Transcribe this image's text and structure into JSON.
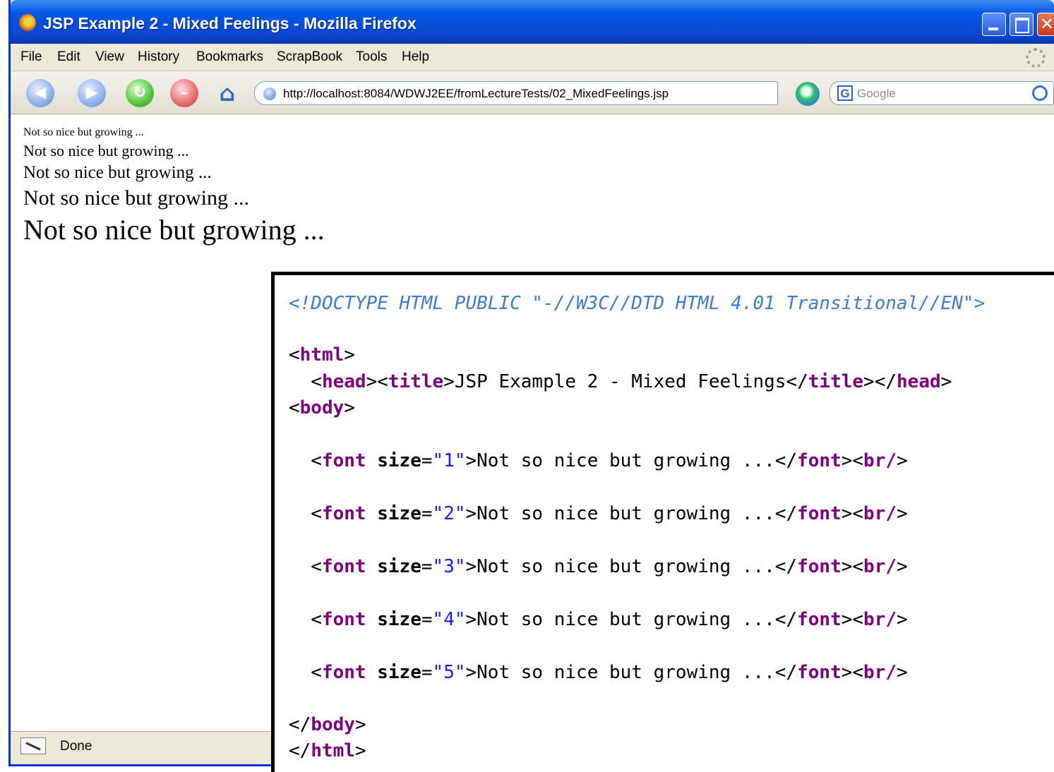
{
  "window": {
    "title": "JSP Example 2 - Mixed Feelings - Mozilla Firefox",
    "controls": [
      "minimize",
      "maximize",
      "close"
    ]
  },
  "menu": [
    "File",
    "Edit",
    "View",
    "History",
    "Bookmarks",
    "ScrapBook",
    "Tools",
    "Help"
  ],
  "toolbar": {
    "url": "http://localhost:8084/WDWJ2EE/fromLectureTests/02_MixedFeelings.jsp",
    "search_placeholder": "Google",
    "buttons": [
      "back",
      "forward",
      "reload",
      "stop",
      "home",
      "go"
    ]
  },
  "page": {
    "lines": [
      "Not so nice but growing ...",
      "Not so nice but growing ...",
      "Not so nice but growing ...",
      "Not so nice but growing ...",
      "Not so nice but growing ..."
    ]
  },
  "status": {
    "text": "Done"
  },
  "source": {
    "doctype": "<!DOCTYPE HTML PUBLIC \"-//W3C//DTD HTML 4.01 Transitional//EN\">",
    "html_open": "html",
    "head_tag": "head",
    "title_tag": "title",
    "title_text": "JSP Example 2 - Mixed Feelings",
    "body_tag": "body",
    "font_tag": "font",
    "size_attr": "size",
    "br_tag": "br",
    "font_text": "Not so nice but growing ...",
    "font_sizes": [
      "1",
      "2",
      "3",
      "4",
      "5"
    ]
  },
  "colors": {
    "titlebar": "#0058e6",
    "tag": "#800080",
    "attr_value": "#1a1aff",
    "doctype": "#3a7bd5"
  }
}
